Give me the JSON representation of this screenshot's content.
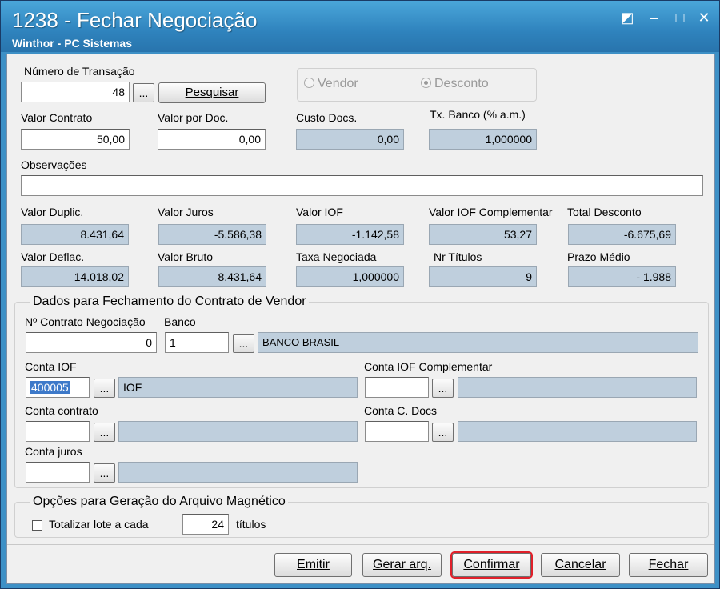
{
  "window": {
    "title": "1238 - Fechar Negociação",
    "subtitle": "Winthor - PC Sistemas",
    "controls": {
      "restore": "◩",
      "minimize": "–",
      "maximize": "□",
      "close": "✕"
    }
  },
  "top": {
    "transacao_label": "Número de Transação",
    "transacao_value": "48",
    "ellipsis": "...",
    "pesquisar": "Pesquisar",
    "radio_vendor": "Vendor",
    "radio_desconto": "Desconto",
    "valor_contrato_label": "Valor Contrato",
    "valor_contrato": "50,00",
    "valor_por_doc_label": "Valor por Doc.",
    "valor_por_doc": "0,00",
    "custo_docs_label": "Custo Docs.",
    "custo_docs": "0,00",
    "tx_banco_label": "Tx. Banco (% a.m.)",
    "tx_banco": "1,000000",
    "observacoes_label": "Observações",
    "observacoes": ""
  },
  "totais": {
    "valor_duplic_label": "Valor Duplic.",
    "valor_duplic": "8.431,64",
    "valor_juros_label": "Valor Juros",
    "valor_juros": "-5.586,38",
    "valor_iof_label": "Valor IOF",
    "valor_iof": "-1.142,58",
    "valor_iof_comp_label": "Valor IOF Complementar",
    "valor_iof_comp": "53,27",
    "total_desconto_label": "Total Desconto",
    "total_desconto": "-6.675,69",
    "valor_deflac_label": "Valor Deflac.",
    "valor_deflac": "14.018,02",
    "valor_bruto_label": "Valor Bruto",
    "valor_bruto": "8.431,64",
    "taxa_negociada_label": "Taxa Negociada",
    "taxa_negociada": "1,000000",
    "nr_titulos_label": "Nr Títulos",
    "nr_titulos": "9",
    "prazo_medio_label": "Prazo Médio",
    "prazo_medio": "- 1.988"
  },
  "vendor": {
    "group_title": "Dados para Fechamento do Contrato de Vendor",
    "contrato_neg_label": "Nº Contrato Negociação",
    "contrato_neg": "0",
    "banco_label": "Banco",
    "banco_code": "1",
    "banco_name": "BANCO BRASIL",
    "conta_iof_label": "Conta IOF",
    "conta_iof": "400005",
    "conta_iof_desc": "IOF",
    "conta_iof_comp_label": "Conta IOF Complementar",
    "conta_iof_comp": "",
    "conta_iof_comp_desc": "",
    "conta_contrato_label": "Conta contrato",
    "conta_contrato": "",
    "conta_contrato_desc": "",
    "conta_cdocs_label": "Conta C. Docs",
    "conta_cdocs": "",
    "conta_cdocs_desc": "",
    "conta_juros_label": "Conta juros",
    "conta_juros": "",
    "conta_juros_desc": ""
  },
  "arquivo": {
    "group_title": "Opções para Geração do Arquivo Magnético",
    "totalizar_label": "Totalizar lote a cada",
    "totalizar_value": "24",
    "titulos_label": "títulos",
    "totalizar_checked": false
  },
  "buttons": {
    "emitir": "Emitir",
    "gerar": "Gerar arq.",
    "confirmar": "Confirmar",
    "cancelar": "Cancelar",
    "fechar": "Fechar"
  },
  "colors": {
    "titlebar": "#3d90c6",
    "readonly_field": "#bfcfdd",
    "highlight": "#e0202a",
    "selection": "#3d79c9"
  }
}
